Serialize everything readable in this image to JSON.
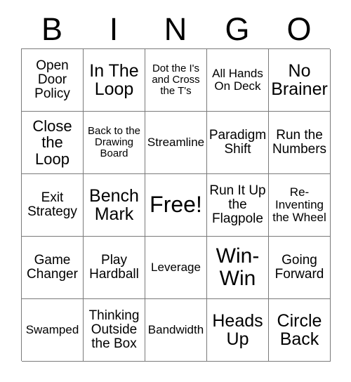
{
  "card": {
    "title_letters": [
      "B",
      "I",
      "N",
      "G",
      "O"
    ],
    "rows": [
      [
        {
          "text": "Open Door Policy",
          "size": "lg"
        },
        {
          "text": "In The Loop",
          "size": "2xl"
        },
        {
          "text": "Dot the I's and Cross the T's",
          "size": "sm"
        },
        {
          "text": "All Hands On Deck",
          "size": "md"
        },
        {
          "text": "No Brainer",
          "size": "2xl"
        }
      ],
      [
        {
          "text": "Close the Loop",
          "size": "xl"
        },
        {
          "text": "Back to the Drawing Board",
          "size": "sm"
        },
        {
          "text": "Streamline",
          "size": "md"
        },
        {
          "text": "Paradigm Shift",
          "size": "lg"
        },
        {
          "text": "Run the Numbers",
          "size": "lg"
        }
      ],
      [
        {
          "text": "Exit Strategy",
          "size": "lg"
        },
        {
          "text": "Bench Mark",
          "size": "2xl"
        },
        {
          "text": "Free!",
          "size": "free"
        },
        {
          "text": "Run It Up the Flagpole",
          "size": "lg"
        },
        {
          "text": "Re-Inventing the Wheel",
          "size": "md"
        }
      ],
      [
        {
          "text": "Game Changer",
          "size": "lg"
        },
        {
          "text": "Play Hardball",
          "size": "lg"
        },
        {
          "text": "Leverage",
          "size": "md"
        },
        {
          "text": "Win-Win",
          "size": "3xl"
        },
        {
          "text": "Going Forward",
          "size": "lg"
        }
      ],
      [
        {
          "text": "Swamped",
          "size": "md"
        },
        {
          "text": "Thinking Outside the Box",
          "size": "lg"
        },
        {
          "text": "Bandwidth",
          "size": "md"
        },
        {
          "text": "Heads Up",
          "size": "2xl"
        },
        {
          "text": "Circle Back",
          "size": "2xl"
        }
      ]
    ],
    "colors": {
      "background": "#ffffff",
      "text": "#000000",
      "grid_line": "#7a7a7a"
    }
  }
}
